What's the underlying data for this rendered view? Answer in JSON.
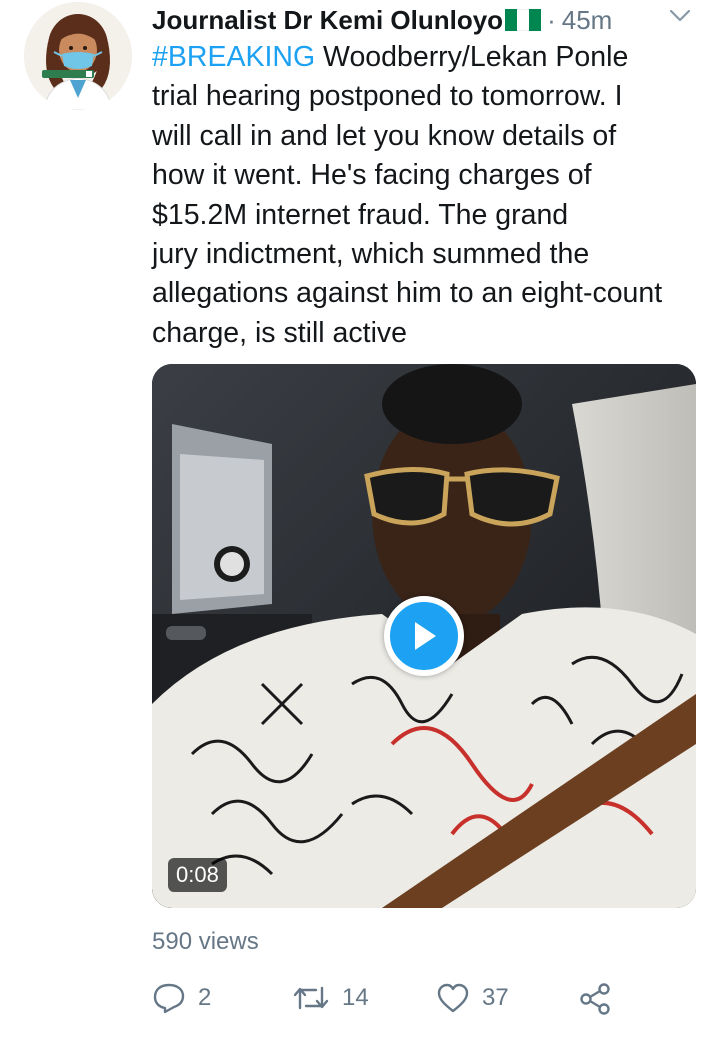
{
  "author": {
    "name": "Journalist Dr Kemi Olunloyo",
    "flag_colors": [
      "#008751",
      "#ffffff",
      "#008751"
    ],
    "timestamp": "45m",
    "separator": "·"
  },
  "tweet": {
    "hashtag": "#BREAKING",
    "lines": [
      " Woodberry/Lekan Ponle",
      "trial hearing postponed to tomorrow. I",
      "will call in and let you know details of",
      "how it went. He's facing charges of",
      "$15.2M internet fraud. The grand",
      "jury indictment, which summed the",
      "allegations against him to an eight-count",
      "charge, is still active"
    ]
  },
  "media": {
    "type": "video",
    "duration": "0:08",
    "accent_color": "#1da1f2"
  },
  "stats": {
    "views": "590 views",
    "replies": "2",
    "retweets": "14",
    "likes": "37"
  },
  "colors": {
    "text": "#14171a",
    "secondary": "#657786",
    "link": "#1da1f2"
  }
}
